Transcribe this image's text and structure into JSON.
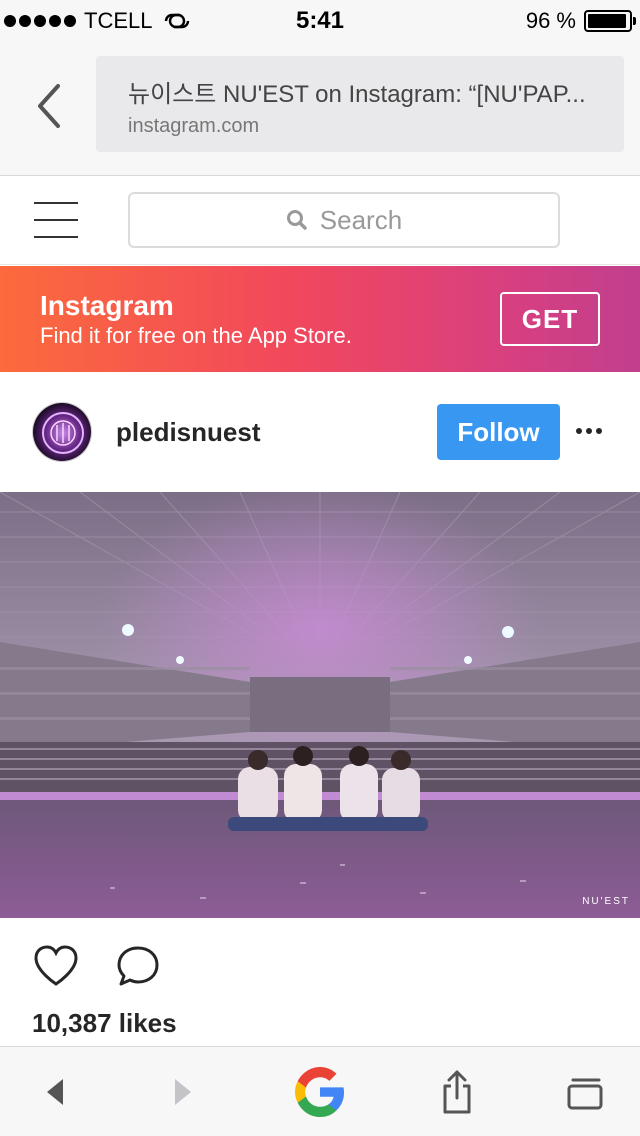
{
  "status_bar": {
    "carrier": "TCELL",
    "time": "5:41",
    "battery_percent": "96 %",
    "battery_level": 0.96
  },
  "browser": {
    "page_title": "뉴이스트 NU'EST on Instagram: “[NU'PAP...",
    "domain": "instagram.com",
    "back_icon": "chevron-left-icon"
  },
  "ig_nav": {
    "menu_icon": "hamburger-menu-icon",
    "search_placeholder": "Search",
    "search_icon": "search-icon"
  },
  "app_banner": {
    "title": "Instagram",
    "subtitle": "Find it for free on the App Store.",
    "cta_label": "GET",
    "colors": [
      "#fb6b3c",
      "#f2485c",
      "#d73f80",
      "#c13f8e"
    ]
  },
  "post": {
    "username": "pledisnuest",
    "follow_label": "Follow",
    "follow_color": "#3897f0",
    "more_icon": "more-dots-icon",
    "photo_watermark": "NU'EST",
    "like_icon": "heart-icon",
    "comment_icon": "comment-icon",
    "likes_text": "10,387 likes"
  },
  "toolbar": {
    "back_icon": "triangle-left-icon",
    "forward_icon": "triangle-right-icon",
    "home_icon": "google-logo-icon",
    "share_icon": "share-icon",
    "tabs_icon": "tabs-icon"
  }
}
